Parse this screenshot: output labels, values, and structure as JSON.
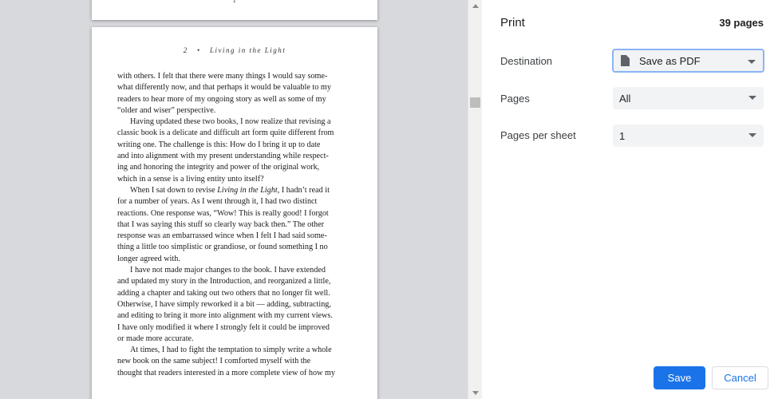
{
  "preview": {
    "prev_page_folio": "1",
    "current_page": {
      "running_head": "2   •   Living in the Light",
      "lines": [
        {
          "text": "with others. I felt that there were many things I would say some-",
          "indent": false
        },
        {
          "text": "what differently now, and that perhaps it would be valuable to my",
          "indent": false
        },
        {
          "text": "readers to hear more of my ongoing story as well as some of my",
          "indent": false
        },
        {
          "text": "“older and wiser” perspective.",
          "indent": false
        },
        {
          "text": "Having updated these two books, I now realize that revising a",
          "indent": true
        },
        {
          "text": "classic book is a delicate and difficult art form quite different from",
          "indent": false
        },
        {
          "text": "writing one. The challenge is this: How do I bring it up to date",
          "indent": false
        },
        {
          "text": "and into alignment with my present understanding while respect-",
          "indent": false
        },
        {
          "text": "ing and honoring the integrity and power of the original work,",
          "indent": false
        },
        {
          "text": "which in a sense is a living entity unto itself?",
          "indent": false
        },
        {
          "text": "When I sat down to revise Living in the Light, I hadn’t read it",
          "indent": true
        },
        {
          "text": "for a number of years. As I went through it, I had two distinct",
          "indent": false
        },
        {
          "text": "reactions. One response was, “Wow! This is really good! I forgot",
          "indent": false
        },
        {
          "text": "that I was saying this stuff so clearly way back then.” The other",
          "indent": false
        },
        {
          "text": "response was an embarrassed wince when I felt I had said some-",
          "indent": false
        },
        {
          "text": "thing a little too simplistic or grandiose, or found something I no",
          "indent": false
        },
        {
          "text": "longer agreed with.",
          "indent": false
        },
        {
          "text": "I have not made major changes to the book. I have extended",
          "indent": true
        },
        {
          "text": "and updated my story in the Introduction, and reorganized a little,",
          "indent": false
        },
        {
          "text": "adding a chapter and taking out two others that no longer fit well.",
          "indent": false
        },
        {
          "text": "Otherwise, I have simply reworked it a bit — adding, subtracting,",
          "indent": false
        },
        {
          "text": "and editing to bring it more into alignment with my current views.",
          "indent": false
        },
        {
          "text": "I have only modified it where I strongly felt it could be improved",
          "indent": false
        },
        {
          "text": "or made more accurate.",
          "indent": false
        },
        {
          "text": "At times, I had to fight the temptation to simply write a whole",
          "indent": true
        },
        {
          "text": "new book on the same subject! I comforted myself with the",
          "indent": false
        },
        {
          "text": "thought that readers interested in a more complete view of how my",
          "indent": false
        }
      ]
    }
  },
  "settings": {
    "title": "Print",
    "page_count": "39 pages",
    "destination": {
      "label": "Destination",
      "value": "Save as PDF",
      "icon": "document-icon"
    },
    "pages": {
      "label": "Pages",
      "value": "All"
    },
    "pages_per_sheet": {
      "label": "Pages per sheet",
      "value": "1"
    },
    "save_label": "Save",
    "cancel_label": "Cancel"
  },
  "colors": {
    "accent": "#1a73e8",
    "preview_background": "#d8d9dc",
    "select_background": "#f1f3f4",
    "focus_ring": "#8ab4f8"
  }
}
